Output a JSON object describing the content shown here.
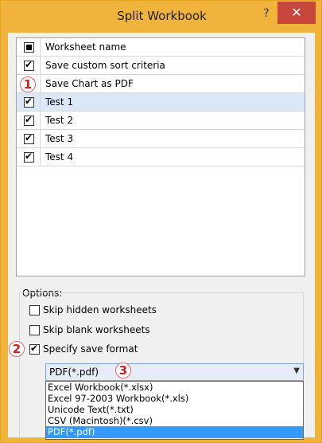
{
  "window": {
    "title": "Split Workbook",
    "help_glyph": "?",
    "close_glyph": "✕"
  },
  "worksheet_list": {
    "header": "Worksheet name",
    "rows": [
      {
        "name": "Save custom sort criteria",
        "checked": true,
        "selected": false
      },
      {
        "name": "Save Chart as PDF",
        "checked": false,
        "selected": false
      },
      {
        "name": "Test 1",
        "checked": true,
        "selected": true
      },
      {
        "name": "Test 2",
        "checked": true,
        "selected": false
      },
      {
        "name": "Test 3",
        "checked": true,
        "selected": false
      },
      {
        "name": "Test 4",
        "checked": true,
        "selected": false
      }
    ]
  },
  "options": {
    "label": "Options:",
    "skip_hidden": {
      "label": "Skip hidden worksheets",
      "checked": false
    },
    "skip_blank": {
      "label": "Skip blank worksheets",
      "checked": false
    },
    "specify_format": {
      "label": "Specify save format",
      "checked": true
    }
  },
  "format_select": {
    "value": "PDF(*.pdf)",
    "options": [
      "Excel Workbook(*.xlsx)",
      "Excel 97-2003 Workbook(*.xls)",
      "Unicode Text(*.txt)",
      "CSV (Macintosh)(*.csv)",
      "PDF(*.pdf)"
    ],
    "selected_index": 4
  },
  "annotations": [
    "1",
    "2",
    "3"
  ],
  "colors": {
    "title_bar": "#f0b43c",
    "close_button": "#c7473c",
    "selected_row": "#d9e7f7",
    "dropdown_highlight": "#3399ff",
    "badge_text": "#d31f1f"
  }
}
